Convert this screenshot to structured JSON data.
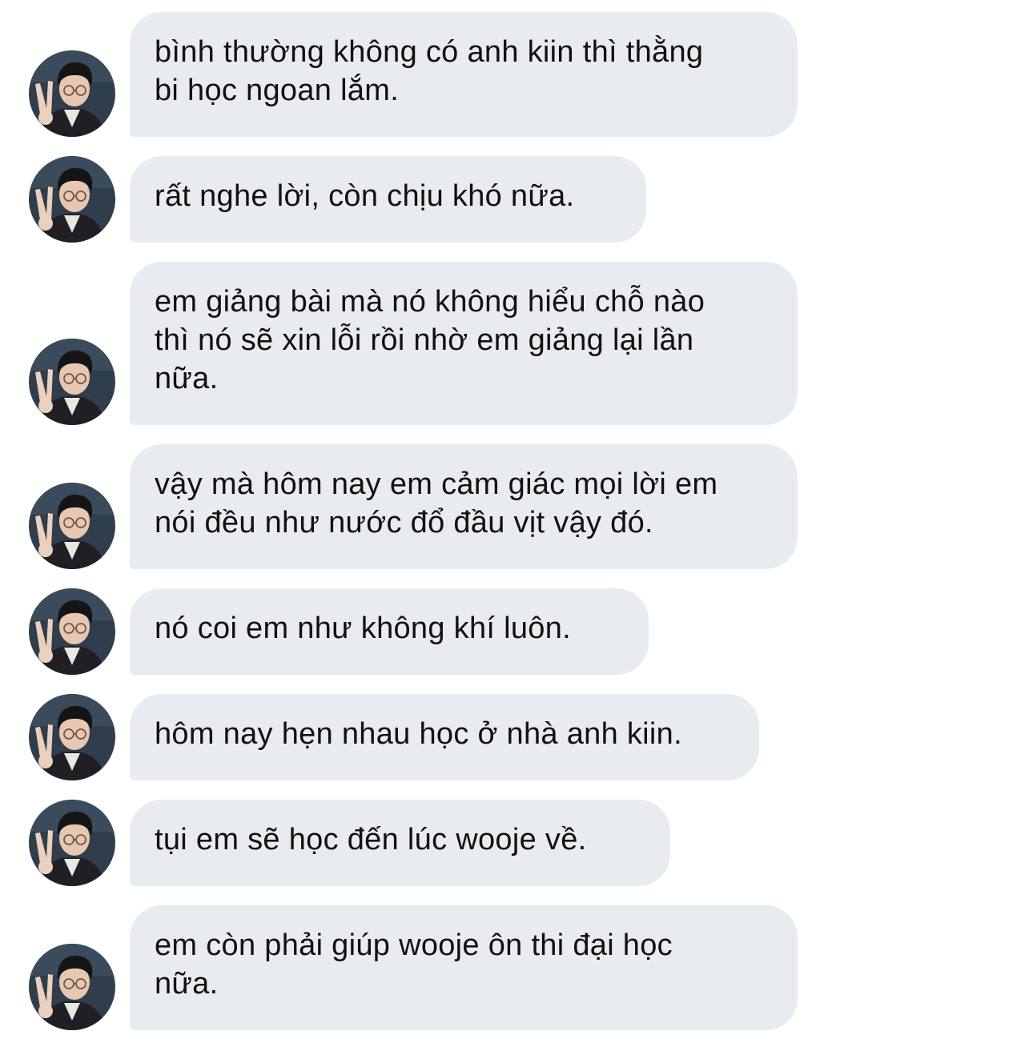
{
  "thread": {
    "sender_avatar_icon": "avatar-photo",
    "bubble_color": "#e8ecf0",
    "messages": [
      {
        "text": "bình thường không có anh kiin thì thằng\nbi học ngoan lắm."
      },
      {
        "text": "rất nghe lời, còn chịu khó nữa."
      },
      {
        "text": "em giảng bài mà nó không hiểu chỗ nào\nthì nó sẽ xin lỗi rồi nhờ em giảng lại lần\nnữa."
      },
      {
        "text": "vậy mà hôm nay em cảm giác mọi lời em\nnói đều như nước đổ đầu vịt vậy đó."
      },
      {
        "text": "nó coi em như không khí luôn."
      },
      {
        "text": "hôm nay hẹn nhau học ở nhà anh kiin."
      },
      {
        "text": "tụi em sẽ học đến lúc wooje về."
      },
      {
        "text": "em còn phải giúp wooje ôn thi đại học\nnữa."
      }
    ]
  }
}
